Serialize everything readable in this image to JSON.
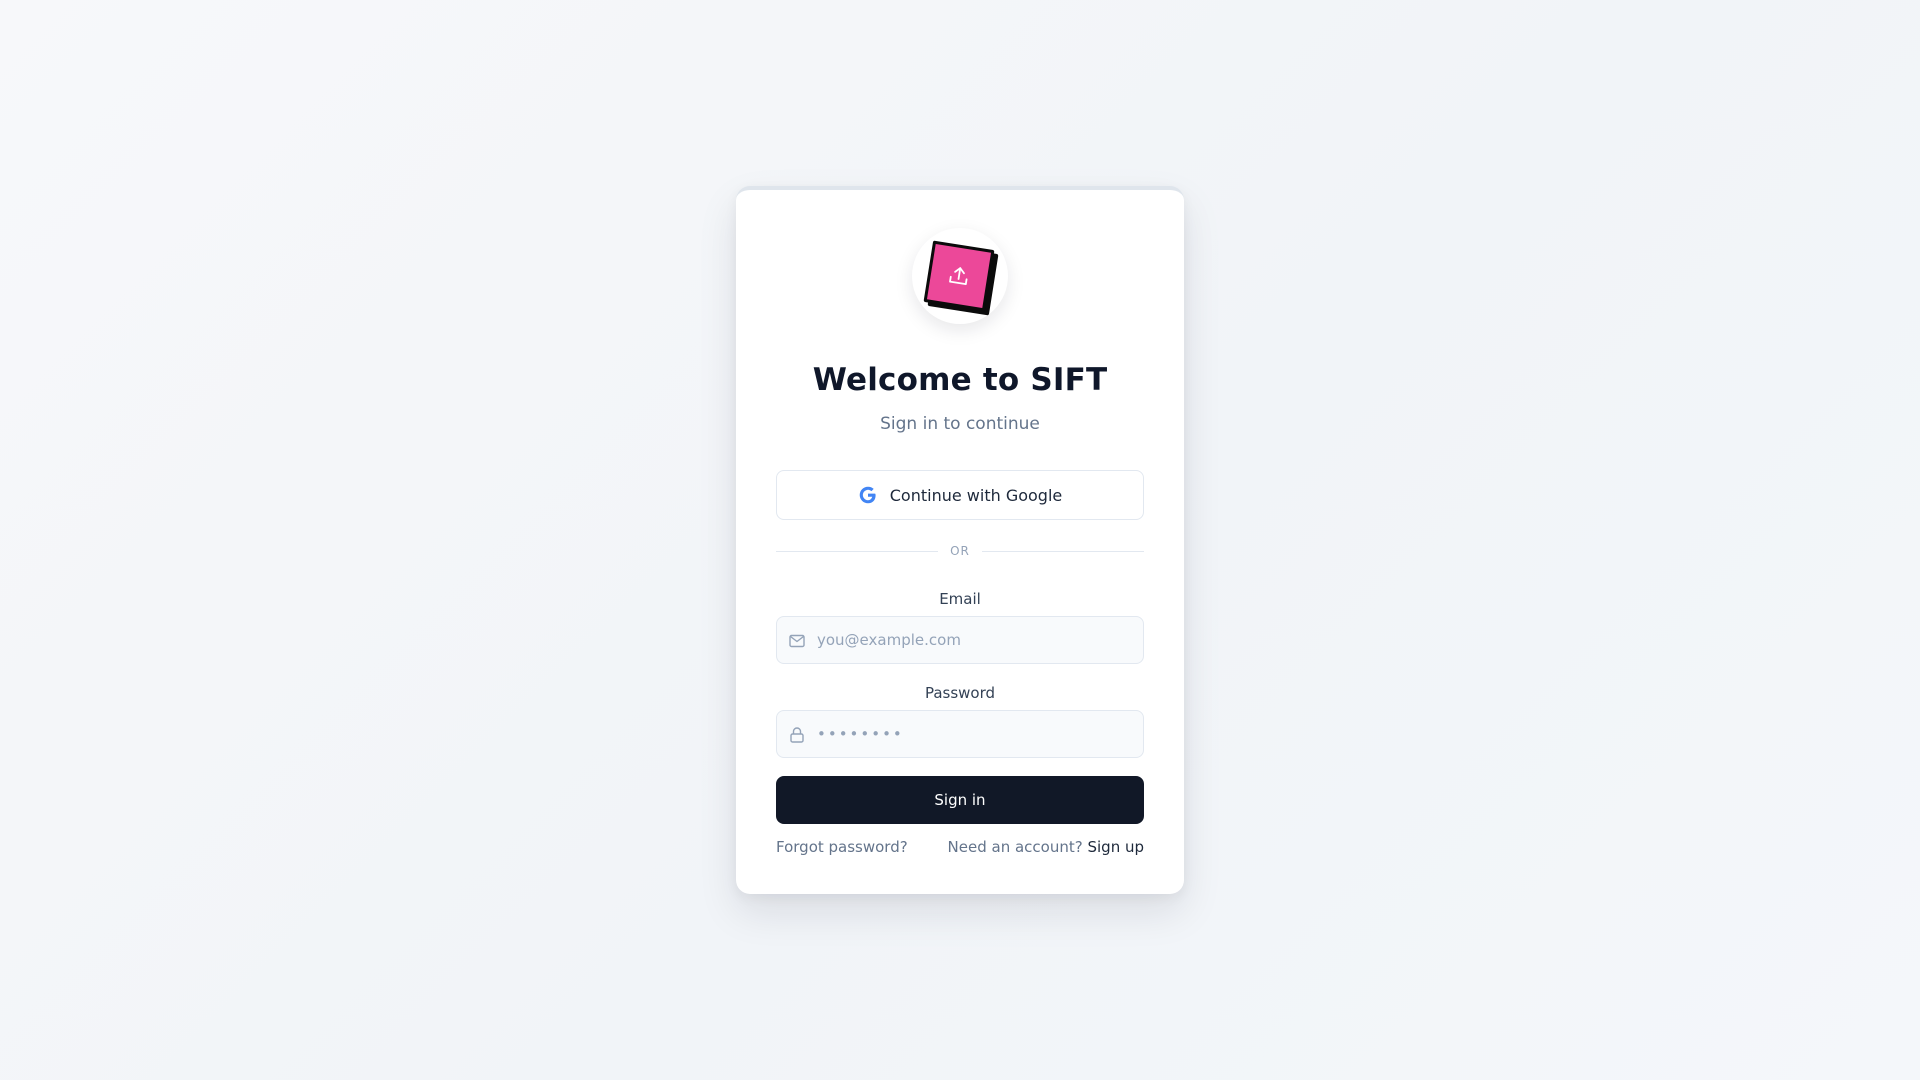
{
  "header": {
    "title": "Welcome to SIFT",
    "subtitle": "Sign in to continue"
  },
  "logo": {
    "icon": "upload-icon",
    "color": "#ec4899"
  },
  "oauth": {
    "google_label": "Continue with Google",
    "google_icon": "google-icon"
  },
  "divider": {
    "label": "OR"
  },
  "form": {
    "email_label": "Email",
    "email_placeholder": "you@example.com",
    "email_icon": "mail-icon",
    "password_label": "Password",
    "password_placeholder": "••••••••",
    "password_icon": "lock-icon",
    "submit_label": "Sign in"
  },
  "footer": {
    "forgot_label": "Forgot password?",
    "need_account_label": "Need an account?",
    "signup_label": "Sign up"
  },
  "colors": {
    "primary_button": "#111827",
    "accent_logo": "#ec4899",
    "google_blue": "#4285f4"
  }
}
